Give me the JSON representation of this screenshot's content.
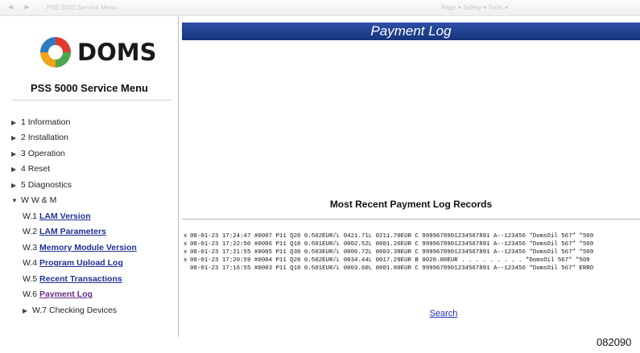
{
  "browser": {
    "nav_glyphs": "◀ ▶",
    "tab_title": "PSS 5000 Service Menu",
    "tools": "Page ▾  Safety ▾  Tools ▾"
  },
  "logo": {
    "text": "DOMS",
    "colors": [
      "#e23b2e",
      "#2e7bc4",
      "#4aa84b",
      "#f0a21b"
    ]
  },
  "sidebar": {
    "title": "PSS 5000 Service Menu",
    "items": [
      {
        "label": "1 Information"
      },
      {
        "label": "2 Installation"
      },
      {
        "label": "3 Operation"
      },
      {
        "label": "4 Reset"
      },
      {
        "label": "5 Diagnostics"
      },
      {
        "label": "W W & M"
      }
    ],
    "subitems": [
      {
        "prefix": "W.1",
        "label": "LAM Version"
      },
      {
        "prefix": "W.2",
        "label": "LAM Parameters"
      },
      {
        "prefix": "W.3",
        "label": "Memory Module Version"
      },
      {
        "prefix": "W.4",
        "label": "Program Upload Log"
      },
      {
        "prefix": "W.5",
        "label": "Recent Transactions"
      },
      {
        "prefix": "W.6",
        "label": "Payment Log"
      },
      {
        "prefix": "",
        "label": "W.7 Checking Devices"
      }
    ]
  },
  "main": {
    "header": "Payment Log",
    "section_title": "Most Recent Payment Log Records",
    "log_rows": [
      {
        "mark": "x",
        "text": "08-01-23 17:24:47 #0007 P11 Q20 0.502EUR/L 0421.71L 0211.70EUR C 9999678901234567891 A--123456 \"DomsOil 567\" \"509"
      },
      {
        "mark": "x",
        "text": "08-01-23 17:22:50 #0006 P11 Q10 0.501EUR/L 0002.52L 0001.26EUR C 9999678901234567891 A--123456 \"DomsOil 567\" \"509"
      },
      {
        "mark": "x",
        "text": "08-01-23 17:21:55 #0005 P11 Q30 0.503EUR/L 0006.72L 0003.38EUR C 9999678901234567891 A--123456 \"DomsOil 567\" \"509"
      },
      {
        "mark": "x",
        "text": "08-01-23 17:20:59 #0004 P11 Q20 0.502EUR/L 0034.44L 0017.29EUR B 0020.00EUR . . . . . . . . .   \"DomsOil 567\" \"509"
      },
      {
        "mark": "",
        "text": "08-01-23 17:16:55 #0003 P11 Q10 0.501EUR/L 0003.60L 0001.80EUR C 9999678901234567891 A--123456 \"DomsOil 567\" ERRO"
      }
    ],
    "search_label": "Search"
  },
  "figure_number": "082090"
}
